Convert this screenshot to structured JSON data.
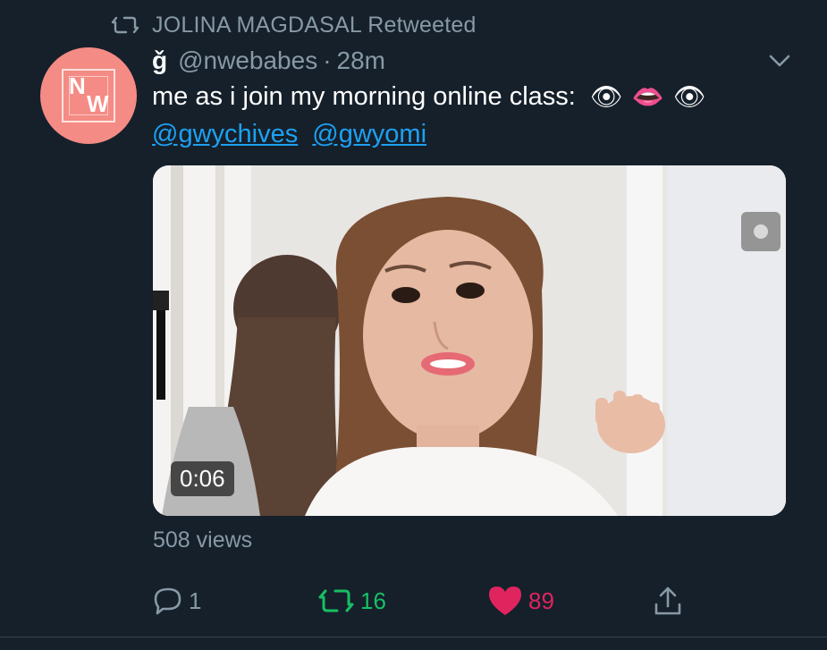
{
  "retweet_banner": {
    "icon": "retweet-icon",
    "text": "JOLINA MAGDASAL Retweeted"
  },
  "author": {
    "avatar_initials": "NW",
    "display_name": "ǧ",
    "handle": "@nwebabes",
    "separator": "·",
    "time": "28m"
  },
  "tweet": {
    "text": "me as i join my morning online class:",
    "emojis": [
      "👁",
      "👄",
      "👁"
    ],
    "mentions": [
      "@gwychives",
      "@gwyomi"
    ]
  },
  "media": {
    "type": "video",
    "duration": "0:06",
    "views": "508 views"
  },
  "actions": {
    "replies": "1",
    "retweets": "16",
    "likes": "89"
  },
  "colors": {
    "background": "#15202b",
    "secondary_text": "#8899a6",
    "link": "#1da1f2",
    "retweet_active": "#17bf63",
    "like_active": "#e0245e",
    "avatar_bg": "#f48b84"
  }
}
